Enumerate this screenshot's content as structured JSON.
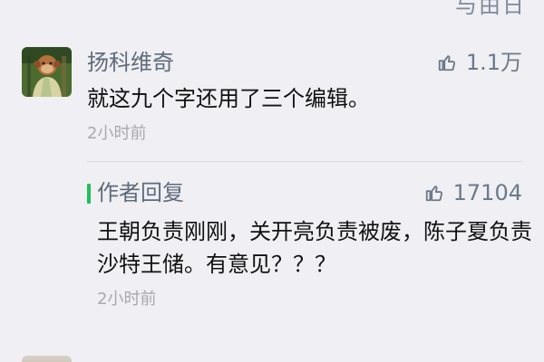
{
  "top_fragment": {
    "text": "与由日"
  },
  "comment": {
    "username": "扬科维奇",
    "text": "就这九个字还用了三个编辑。",
    "time": "2小时前",
    "likes": "1.1万",
    "like_icon": "thumbs-up-icon",
    "avatar_icon": "monkey-avatar"
  },
  "reply": {
    "title": "作者回复",
    "text": "王朝负责刚刚，关开亮负责被废，陈子夏负责沙特王储。有意见？？？",
    "time": "2小时前",
    "likes": "17104",
    "like_icon": "thumbs-up-icon",
    "accent_color": "#20c05a"
  },
  "colors": {
    "background": "#efeff4",
    "username": "#5f6b7a",
    "timestamp": "#a8a8ad",
    "text": "#111111"
  }
}
